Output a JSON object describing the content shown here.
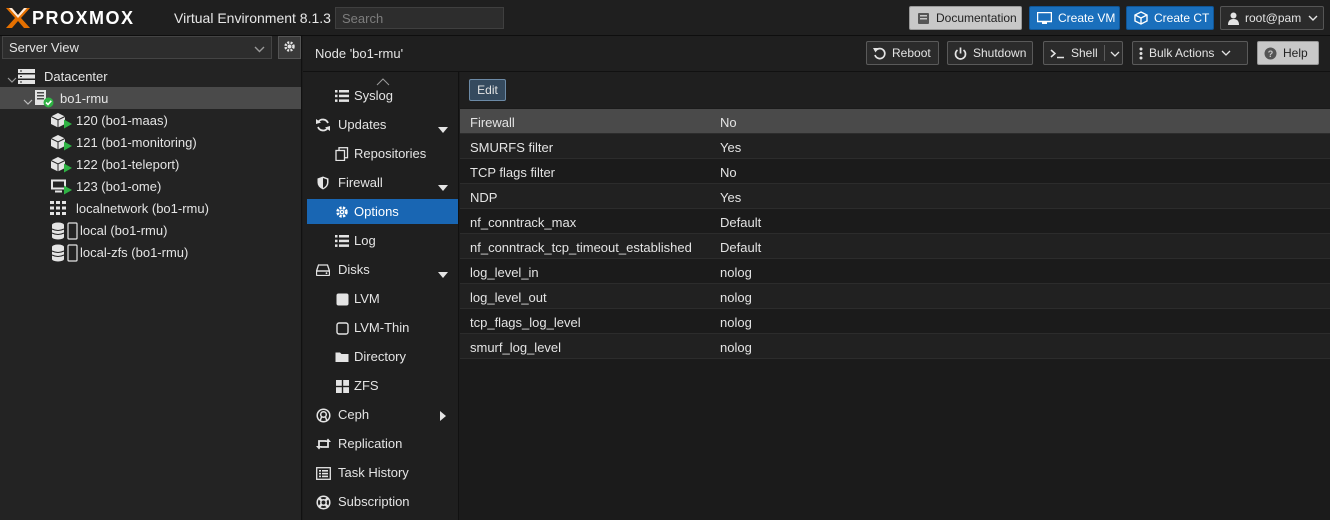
{
  "topbar": {
    "brand": "PROXMOX",
    "version": "Virtual Environment 8.1.3",
    "search_placeholder": "Search",
    "documentation": "Documentation",
    "create_vm": "Create VM",
    "create_ct": "Create CT",
    "user": "root@pam"
  },
  "sidebar": {
    "view": "Server View",
    "tree": [
      {
        "label": "Datacenter",
        "icon": "server-rack-icon"
      },
      {
        "label": "bo1-rmu",
        "icon": "node-online-icon"
      },
      {
        "label": "120 (bo1-maas)",
        "icon": "container-running-icon"
      },
      {
        "label": "121 (bo1-monitoring)",
        "icon": "container-running-icon"
      },
      {
        "label": "122 (bo1-teleport)",
        "icon": "container-running-icon"
      },
      {
        "label": "123 (bo1-ome)",
        "icon": "vm-running-icon"
      },
      {
        "label": "localnetwork (bo1-rmu)",
        "icon": "network-grid-icon"
      },
      {
        "label": "local (bo1-rmu)",
        "icon": "storage-icon"
      },
      {
        "label": "local-zfs (bo1-rmu)",
        "icon": "storage-icon"
      }
    ]
  },
  "header": {
    "title": "Node 'bo1-rmu'",
    "reboot": "Reboot",
    "shutdown": "Shutdown",
    "shell": "Shell",
    "bulk": "Bulk Actions",
    "help": "Help"
  },
  "nav": {
    "items": [
      {
        "label": "Syslog"
      },
      {
        "label": "Updates"
      },
      {
        "label": "Repositories"
      },
      {
        "label": "Firewall"
      },
      {
        "label": "Options"
      },
      {
        "label": "Log"
      },
      {
        "label": "Disks"
      },
      {
        "label": "LVM"
      },
      {
        "label": "LVM-Thin"
      },
      {
        "label": "Directory"
      },
      {
        "label": "ZFS"
      },
      {
        "label": "Ceph"
      },
      {
        "label": "Replication"
      },
      {
        "label": "Task History"
      },
      {
        "label": "Subscription"
      }
    ]
  },
  "toolbar": {
    "edit": "Edit"
  },
  "options": {
    "rows": [
      {
        "key": "Firewall",
        "value": "No"
      },
      {
        "key": "SMURFS filter",
        "value": "Yes"
      },
      {
        "key": "TCP flags filter",
        "value": "No"
      },
      {
        "key": "NDP",
        "value": "Yes"
      },
      {
        "key": "nf_conntrack_max",
        "value": "Default"
      },
      {
        "key": "nf_conntrack_tcp_timeout_established",
        "value": "Default"
      },
      {
        "key": "log_level_in",
        "value": "nolog"
      },
      {
        "key": "log_level_out",
        "value": "nolog"
      },
      {
        "key": "tcp_flags_log_level",
        "value": "nolog"
      },
      {
        "key": "smurf_log_level",
        "value": "nolog"
      }
    ]
  },
  "colors": {
    "accent": "#1966b3",
    "primary_button": "#1a6fbc",
    "running": "#2fb344"
  }
}
